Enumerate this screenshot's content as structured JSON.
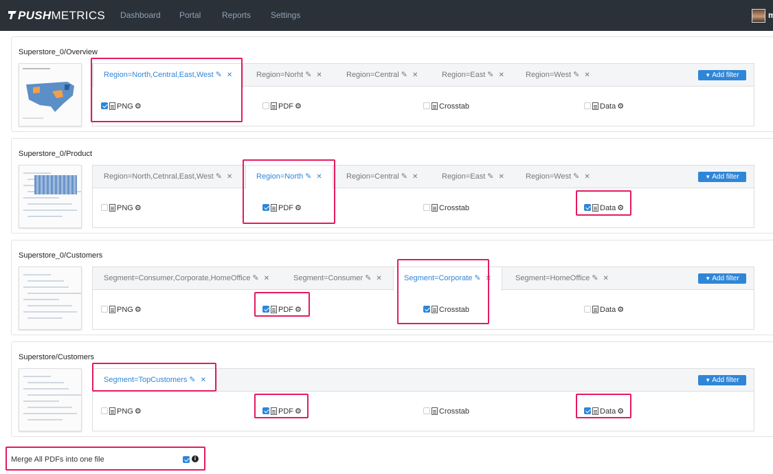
{
  "nav": {
    "logo_bold": "PUSH",
    "logo_light": "METRICS",
    "items": [
      "Dashboard",
      "Portal",
      "Reports",
      "Settings"
    ],
    "user_initial": "m"
  },
  "common": {
    "add_filter": "Add filter",
    "formats": [
      "PNG",
      "PDF",
      "Crosstab",
      "Data"
    ]
  },
  "reports": [
    {
      "title": "Superstore_0/Overview",
      "filters": [
        "Region=North,Central,East,West",
        "Region=Norht",
        "Region=Central",
        "Region=East",
        "Region=West"
      ],
      "active_filter": 0,
      "checked": {
        "PNG": true,
        "PDF": false,
        "Crosstab": false,
        "Data": false
      }
    },
    {
      "title": "Superstore_0/Product",
      "filters": [
        "Region=North,Cetnral,East,West",
        "Region=North",
        "Region=Central",
        "Region=East",
        "Region=West"
      ],
      "active_filter": 1,
      "checked": {
        "PNG": false,
        "PDF": true,
        "Crosstab": false,
        "Data": true
      }
    },
    {
      "title": "Superstore_0/Customers",
      "filters": [
        "Segment=Consumer,Corporate,HomeOffice",
        "Segment=Consumer",
        "Segment=Corporate",
        "Segment=HomeOffice"
      ],
      "active_filter": 2,
      "checked": {
        "PNG": false,
        "PDF": true,
        "Crosstab": true,
        "Data": false
      }
    },
    {
      "title": "Superstore/Customers",
      "filters": [
        "Segment=TopCustomers"
      ],
      "active_filter": 0,
      "checked": {
        "PNG": false,
        "PDF": true,
        "Crosstab": false,
        "Data": true
      }
    }
  ],
  "merge": {
    "label": "Merge All PDFs into one file",
    "checked": true
  },
  "colors": {
    "navbar": "#2b3138",
    "accent": "#2f86d8",
    "highlight": "#e5195e"
  }
}
